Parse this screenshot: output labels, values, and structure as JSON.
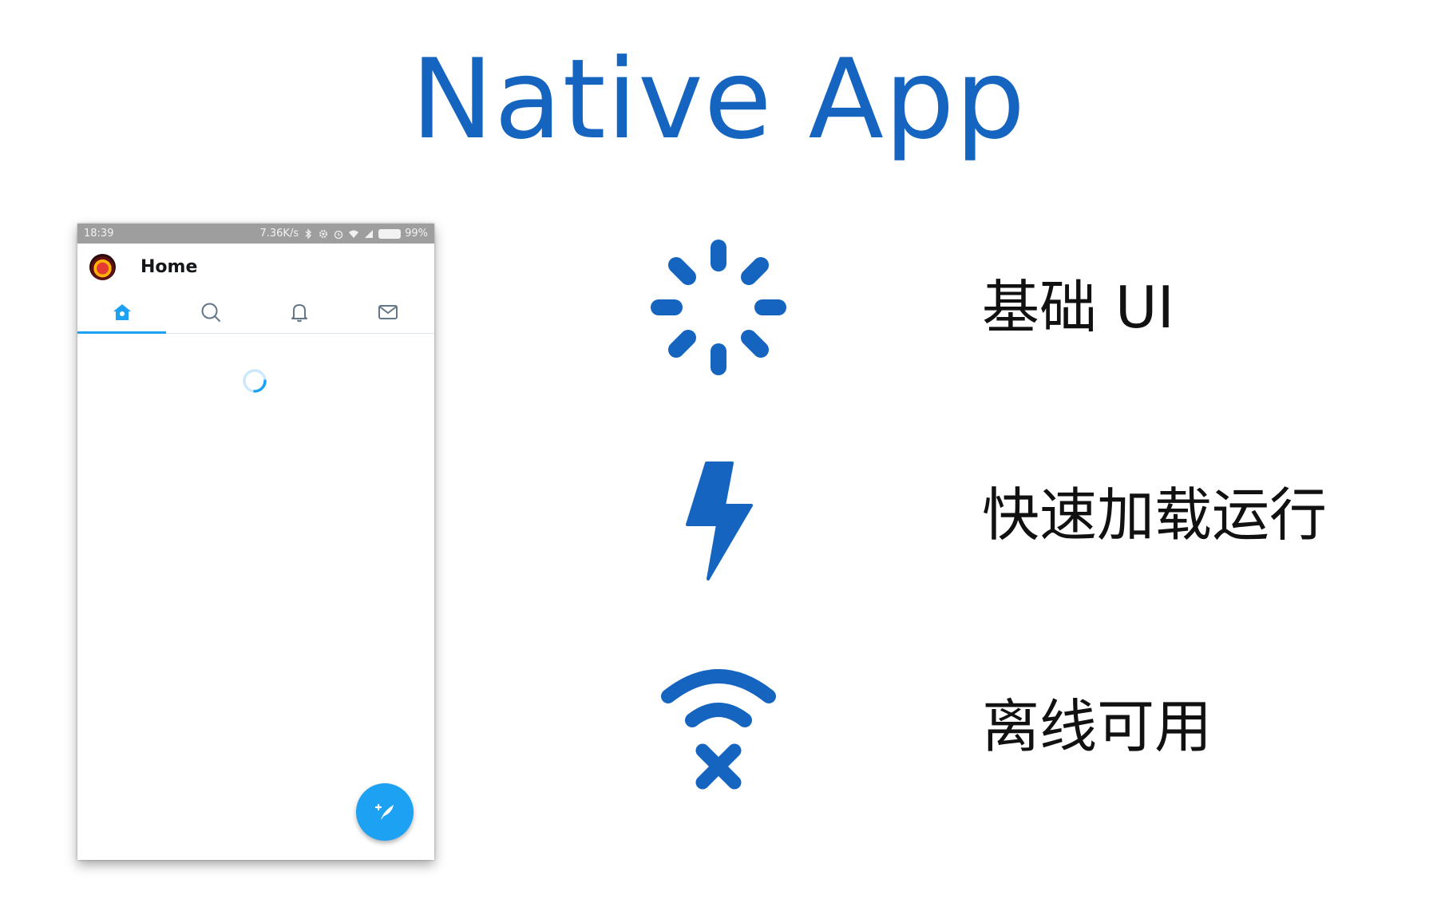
{
  "slide": {
    "title": "Native App",
    "accent_color": "#1565c0"
  },
  "phone": {
    "status_bar": {
      "time": "18:39",
      "network_speed": "7.36K/s",
      "battery": "99%",
      "icons": [
        "bluetooth-icon",
        "gear-icon",
        "alarm-icon",
        "wifi-icon",
        "signal-icon",
        "battery-icon"
      ]
    },
    "app_bar": {
      "title": "Home",
      "avatar": "avatar"
    },
    "tabs": [
      {
        "icon": "home-icon",
        "selected": true
      },
      {
        "icon": "search-icon",
        "selected": false
      },
      {
        "icon": "bell-icon",
        "selected": false
      },
      {
        "icon": "mail-icon",
        "selected": false
      }
    ],
    "content": {
      "state": "loading",
      "indicator": "spinner-icon"
    },
    "fab": {
      "icon": "compose-icon"
    },
    "brand_color": "#1da1f2"
  },
  "features": [
    {
      "icon": "spinner-icon",
      "label": "基础 UI"
    },
    {
      "icon": "lightning-icon",
      "label": "快速加载运行"
    },
    {
      "icon": "wifi-off-icon",
      "label": "离线可用"
    }
  ]
}
